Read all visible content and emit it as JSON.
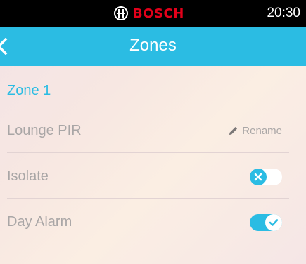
{
  "status_bar": {
    "brand": "BOSCH",
    "time": "20:30"
  },
  "nav": {
    "title": "Zones"
  },
  "section": {
    "title": "Zone 1"
  },
  "zone": {
    "name": "Lounge PIR",
    "rename_label": "Rename"
  },
  "settings": [
    {
      "label": "Isolate",
      "enabled": false
    },
    {
      "label": "Day Alarm",
      "enabled": true
    }
  ],
  "colors": {
    "accent": "#2bbce3",
    "brand": "#e2001a",
    "status_bar_bg": "#000000",
    "text_muted": "#a9a6a6"
  },
  "icons": {
    "back": "chevron-left-icon",
    "rename": "pencil-icon",
    "toggle_off": "x-icon",
    "toggle_on": "check-icon"
  }
}
